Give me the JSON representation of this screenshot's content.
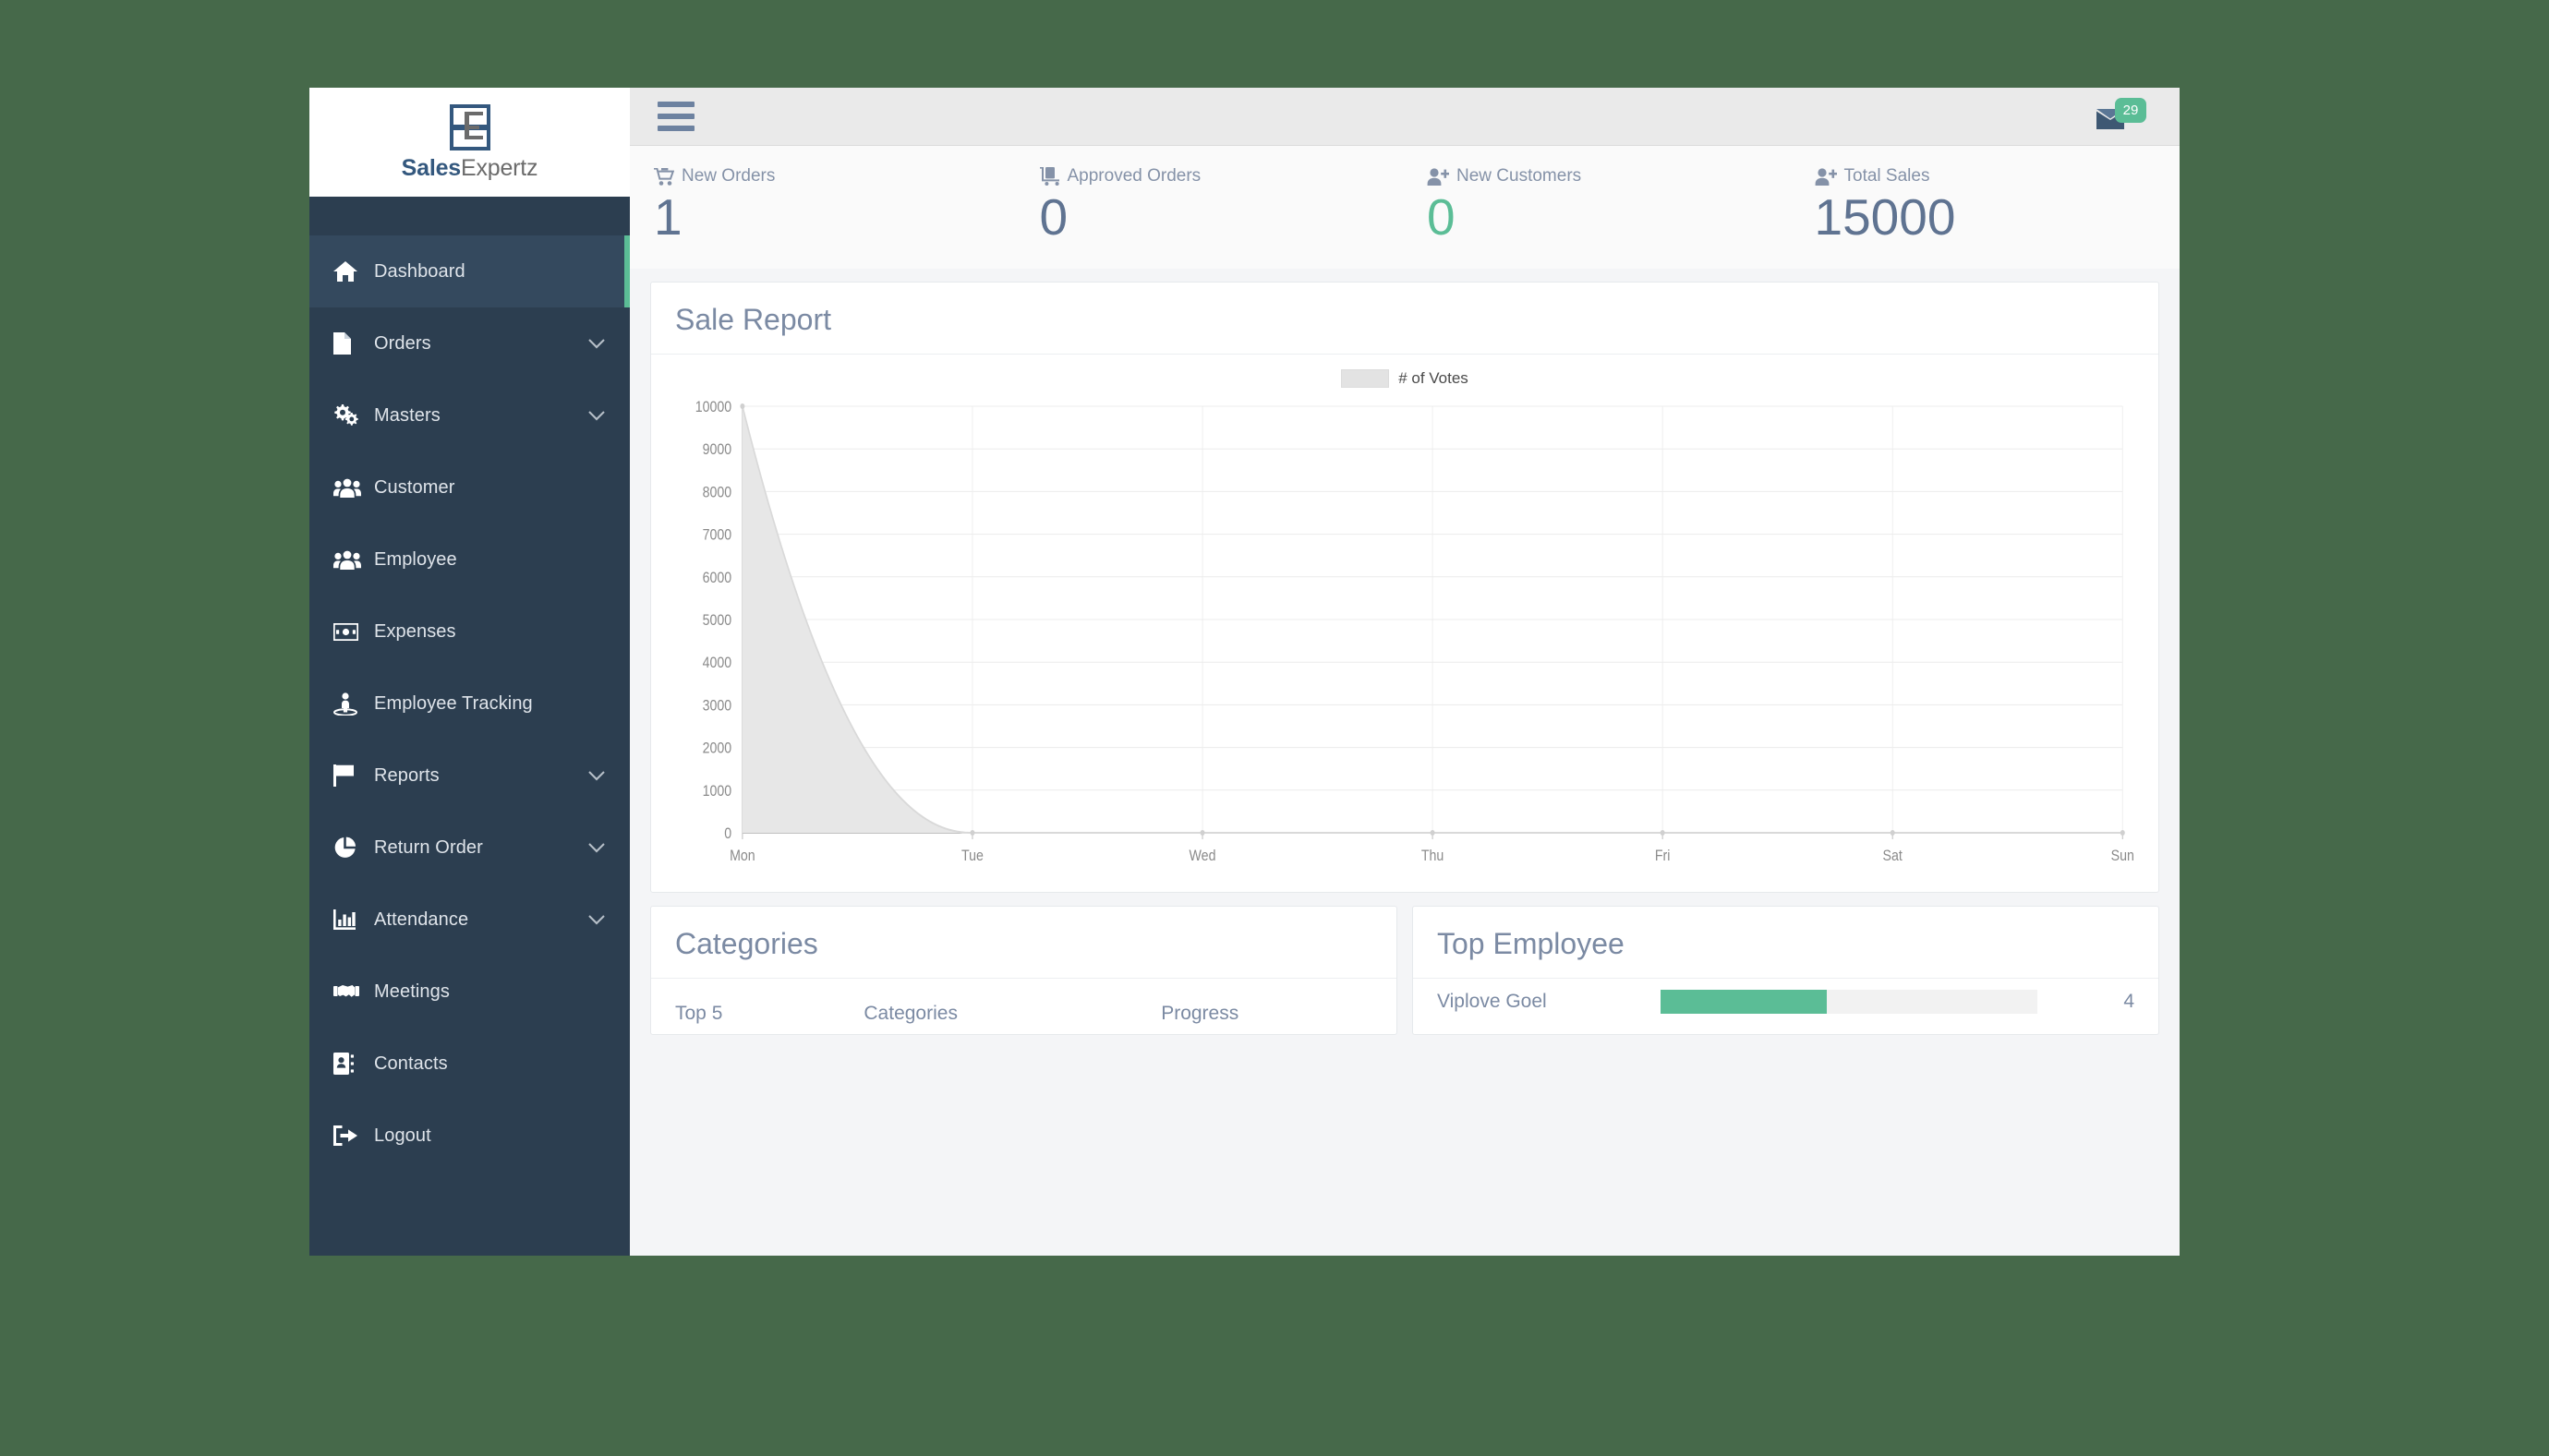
{
  "brand": {
    "name_bold": "Sales",
    "name_light": "Expertz"
  },
  "sidebar": {
    "items": [
      {
        "label": "Dashboard",
        "icon": "home-icon",
        "caret": false,
        "active": true
      },
      {
        "label": "Orders",
        "icon": "file-icon",
        "caret": true,
        "active": false
      },
      {
        "label": "Masters",
        "icon": "cogs-icon",
        "caret": true,
        "active": false
      },
      {
        "label": "Customer",
        "icon": "users-icon",
        "caret": false,
        "active": false
      },
      {
        "label": "Employee",
        "icon": "users-icon",
        "caret": false,
        "active": false
      },
      {
        "label": "Expenses",
        "icon": "money-bill-icon",
        "caret": false,
        "active": false
      },
      {
        "label": "Employee Tracking",
        "icon": "street-view-icon",
        "caret": false,
        "active": false
      },
      {
        "label": "Reports",
        "icon": "flag-icon",
        "caret": true,
        "active": false
      },
      {
        "label": "Return Order",
        "icon": "chart-pie-icon",
        "caret": true,
        "active": false
      },
      {
        "label": "Attendance",
        "icon": "chart-bar-icon",
        "caret": true,
        "active": false
      },
      {
        "label": "Meetings",
        "icon": "handshake-icon",
        "caret": false,
        "active": false
      },
      {
        "label": "Contacts",
        "icon": "address-book-icon",
        "caret": false,
        "active": false
      },
      {
        "label": "Logout",
        "icon": "sign-out-icon",
        "caret": false,
        "active": false
      }
    ]
  },
  "topbar": {
    "menu_toggle": "hamburger-icon",
    "mail_icon": "envelope-icon",
    "mail_badge": "29"
  },
  "stats": [
    {
      "label": "New Orders",
      "value": "1",
      "icon": "shopping-cart-icon",
      "accent": false
    },
    {
      "label": "Approved Orders",
      "value": "0",
      "icon": "cart-flatbed-icon",
      "accent": false
    },
    {
      "label": "New Customers",
      "value": "0",
      "icon": "user-plus-icon",
      "accent": true
    },
    {
      "label": "Total Sales",
      "value": "15000",
      "icon": "user-plus-icon",
      "accent": false
    }
  ],
  "sale_report": {
    "title": "Sale Report"
  },
  "chart_data": {
    "type": "area",
    "title": "Sale Report",
    "xlabel": "",
    "ylabel": "",
    "categories": [
      "Mon",
      "Tue",
      "Wed",
      "Thu",
      "Fri",
      "Sat",
      "Sun"
    ],
    "series": [
      {
        "name": "# of Votes",
        "values": [
          10000,
          0,
          0,
          0,
          0,
          0,
          0
        ]
      }
    ],
    "legend": [
      "# of Votes"
    ],
    "legend_position": "top-center",
    "ylim": [
      0,
      10000
    ],
    "yticks": [
      0,
      1000,
      2000,
      3000,
      4000,
      5000,
      6000,
      7000,
      8000,
      9000,
      10000
    ],
    "grid": true,
    "fill_color": "#e7e7e7",
    "line_color": "#d9d9d9",
    "curve": "smooth-decay"
  },
  "categories_card": {
    "title": "Categories",
    "columns": [
      "Top 5",
      "Categories",
      "Progress"
    ],
    "rows": []
  },
  "top_employee_card": {
    "title": "Top Employee",
    "rows": [
      {
        "name": "Viplove Goel",
        "progress": 44,
        "count": "4"
      }
    ]
  },
  "colors": {
    "page_backdrop": "#46694a",
    "sidebar": "#2c3e50",
    "sidebar_active": "#34495e",
    "accent_green": "#5bbd96",
    "brand_blue": "#34587e",
    "heading_text": "#7b8aa3",
    "stat_text": "#5f7391"
  }
}
